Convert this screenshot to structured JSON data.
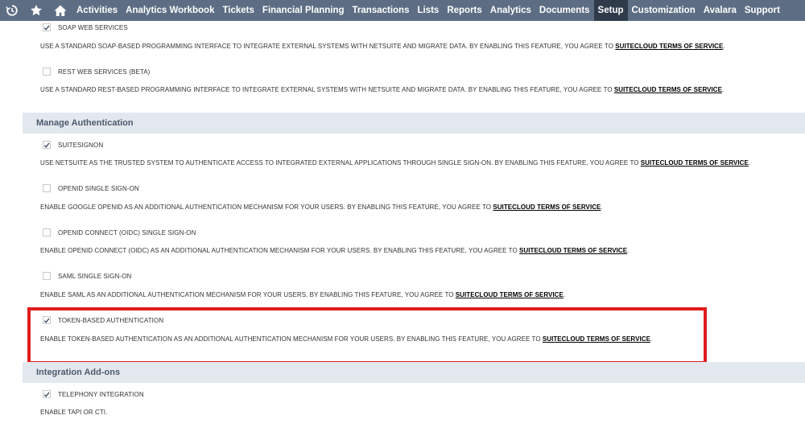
{
  "nav": {
    "items": [
      "Activities",
      "Analytics Workbook",
      "Tickets",
      "Financial Planning",
      "Transactions",
      "Lists",
      "Reports",
      "Analytics",
      "Documents",
      "Setup",
      "Customization",
      "Avalara",
      "Support"
    ],
    "active": "Setup"
  },
  "features": {
    "soap": {
      "label": "SOAP WEB SERVICES",
      "checked": true,
      "desc": "USE A STANDARD SOAP-BASED PROGRAMMING INTERFACE TO INTEGRATE EXTERNAL SYSTEMS WITH NETSUITE AND MIGRATE DATA. BY ENABLING THIS FEATURE, YOU AGREE TO ",
      "link": "SUITECLOUD TERMS OF SERVICE",
      "tail": "."
    },
    "rest": {
      "label": "REST WEB SERVICES (BETA)",
      "checked": false,
      "desc": "USE A STANDARD REST-BASED PROGRAMMING INTERFACE TO INTEGRATE EXTERNAL SYSTEMS WITH NETSUITE AND MIGRATE DATA. BY ENABLING THIS FEATURE, YOU AGREE TO ",
      "link": "SUITECLOUD TERMS OF SERVICE",
      "tail": "."
    },
    "manage_auth_header": "Manage Authentication",
    "suitesignon": {
      "label": "SUITESIGNON",
      "checked": true,
      "desc": "USE NETSUITE AS THE TRUSTED SYSTEM TO AUTHENTICATE ACCESS TO INTEGRATED EXTERNAL APPLICATIONS THROUGH SINGLE SIGN-ON. BY ENABLING THIS FEATURE, YOU AGREE TO ",
      "link": "SUITECLOUD TERMS OF SERVICE",
      "tail": "."
    },
    "openid": {
      "label": "OPENID SINGLE SIGN-ON",
      "checked": false,
      "desc": "ENABLE GOOGLE OPENID AS AN ADDITIONAL AUTHENTICATION MECHANISM FOR YOUR USERS. BY ENABLING THIS FEATURE, YOU AGREE TO ",
      "link": "SUITECLOUD TERMS OF SERVICE",
      "tail": "."
    },
    "oidc": {
      "label": "OPENID CONNECT (OIDC) SINGLE SIGN-ON",
      "checked": false,
      "desc": "ENABLE OPENID CONNECT (OIDC) AS AN ADDITIONAL AUTHENTICATION MECHANISM FOR YOUR USERS. BY ENABLING THIS FEATURE, YOU AGREE TO ",
      "link": "SUITECLOUD TERMS OF SERVICE",
      "tail": "."
    },
    "saml": {
      "label": "SAML SINGLE SIGN-ON",
      "checked": false,
      "desc": "ENABLE SAML AS AN ADDITIONAL AUTHENTICATION MECHANISM FOR YOUR USERS. BY ENABLING THIS FEATURE, YOU AGREE TO ",
      "link": "SUITECLOUD TERMS OF SERVICE",
      "tail": "."
    },
    "tba": {
      "label": "TOKEN-BASED AUTHENTICATION",
      "checked": true,
      "desc": "ENABLE TOKEN-BASED AUTHENTICATION AS AN ADDITIONAL AUTHENTICATION MECHANISM FOR YOUR USERS. BY ENABLING THIS FEATURE, YOU AGREE TO ",
      "link": "SUITECLOUD TERMS OF SERVICE",
      "tail": "."
    },
    "integration_header": "Integration Add-ons",
    "telephony": {
      "label": "TELEPHONY INTEGRATION",
      "checked": true,
      "desc": "ENABLE TAPI OR CTI."
    }
  },
  "colors": {
    "nav_bg": "#5d6e84",
    "nav_active": "#2f3b4a",
    "section_bg": "#e3e8ef",
    "highlight": "#e01c1c"
  },
  "icons": [
    "recent-icon",
    "star-icon",
    "home-icon",
    "checkmark-icon"
  ]
}
